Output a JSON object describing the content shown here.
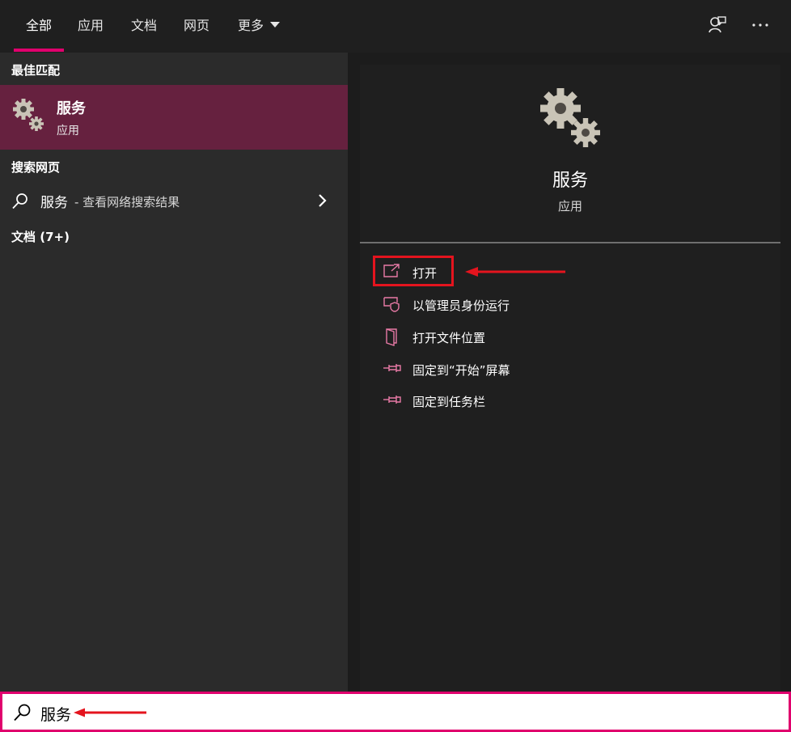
{
  "tabs": [
    {
      "label": "全部",
      "active": true
    },
    {
      "label": "应用"
    },
    {
      "label": "文档"
    },
    {
      "label": "网页"
    },
    {
      "label": "更多"
    }
  ],
  "left": {
    "best_match_header": "最佳匹配",
    "best_match": {
      "title": "服务",
      "subtitle": "应用"
    },
    "web_header": "搜索网页",
    "web_result": {
      "query": "服务",
      "suffix": " - 查看网络搜索结果"
    },
    "docs_header": "文档 (7+)"
  },
  "right": {
    "title": "服务",
    "subtitle": "应用",
    "actions": [
      {
        "label": "打开",
        "icon": "open-external-icon"
      },
      {
        "label": "以管理员身份运行",
        "icon": "shield-icon"
      },
      {
        "label": "打开文件位置",
        "icon": "file-location-icon"
      },
      {
        "label": "固定到“开始”屏幕",
        "icon": "pin-icon"
      },
      {
        "label": "固定到任务栏",
        "icon": "pin-icon"
      }
    ]
  },
  "search": {
    "value": "服务",
    "icon": "search-icon"
  },
  "colors": {
    "accent": "#e0006d",
    "selected_row": "#66213f",
    "annotation": "#e4141e",
    "action_icon": "#e87aa6"
  }
}
